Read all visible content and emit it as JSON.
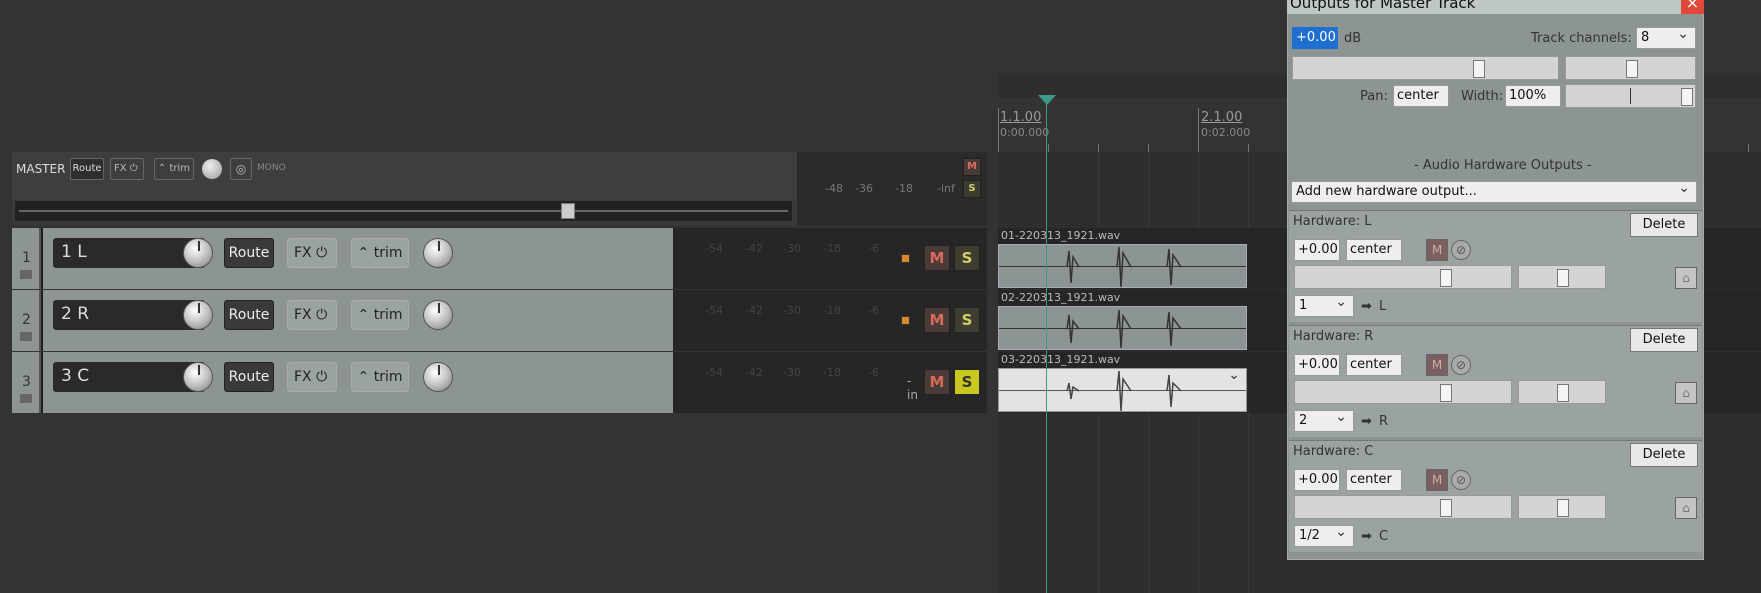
{
  "ruler": {
    "marks": [
      {
        "label": "1.1.00",
        "time": "0:00.000"
      },
      {
        "label": "2.1.00",
        "time": "0:02.000"
      }
    ]
  },
  "master": {
    "name": "MASTER",
    "route_label": "Route",
    "fx_label": "FX",
    "trim_label": "trim",
    "mono_label": "MONO",
    "mute_label": "M",
    "solo_label": "S",
    "meter_scale": [
      "-48",
      "-36",
      "-18",
      "-inf"
    ]
  },
  "tracks": [
    {
      "num": "1",
      "name": "1 L",
      "route_label": "Route",
      "fx_label": "FX",
      "trim_label": "trim",
      "mute_label": "M",
      "solo_label": "S",
      "solo_on": false,
      "peak": "",
      "item": "01-220313_1921.wav"
    },
    {
      "num": "2",
      "name": "2 R",
      "route_label": "Route",
      "fx_label": "FX",
      "trim_label": "trim",
      "mute_label": "M",
      "solo_label": "S",
      "solo_on": false,
      "peak": "",
      "item": "02-220313_1921.wav"
    },
    {
      "num": "3",
      "name": "3 C",
      "route_label": "Route",
      "fx_label": "FX",
      "trim_label": "trim",
      "mute_label": "M",
      "solo_label": "S",
      "solo_on": true,
      "peak": "-inf",
      "item": "03-220313_1921.wav"
    }
  ],
  "track_meter_scale": [
    "-54",
    "-42",
    "-30",
    "-18",
    "-6"
  ],
  "dialog": {
    "title": "Outputs for Master Track",
    "close_label": "×",
    "volume_value": "+0.00",
    "db_label": "dB",
    "channels_label": "Track channels:",
    "channels_value": "8",
    "pan_label": "Pan:",
    "pan_value": "center",
    "width_label": "Width:",
    "width_value": "100%",
    "hw_header": "- Audio Hardware Outputs -",
    "add_output": "Add new hardware output...",
    "hardware": [
      {
        "title": "Hardware: L",
        "delete": "Delete",
        "vol": "+0.00",
        "pan": "center",
        "mute": "M",
        "channel": "1",
        "dest": "L"
      },
      {
        "title": "Hardware: R",
        "delete": "Delete",
        "vol": "+0.00",
        "pan": "center",
        "mute": "M",
        "channel": "2",
        "dest": "R"
      },
      {
        "title": "Hardware: C",
        "delete": "Delete",
        "vol": "+0.00",
        "pan": "center",
        "mute": "M",
        "channel": "1/2",
        "dest": "C"
      }
    ]
  },
  "colors": {
    "accent": "#3d9a8a",
    "solo_on": "#c8c81e",
    "mute": "#d76b5a"
  }
}
